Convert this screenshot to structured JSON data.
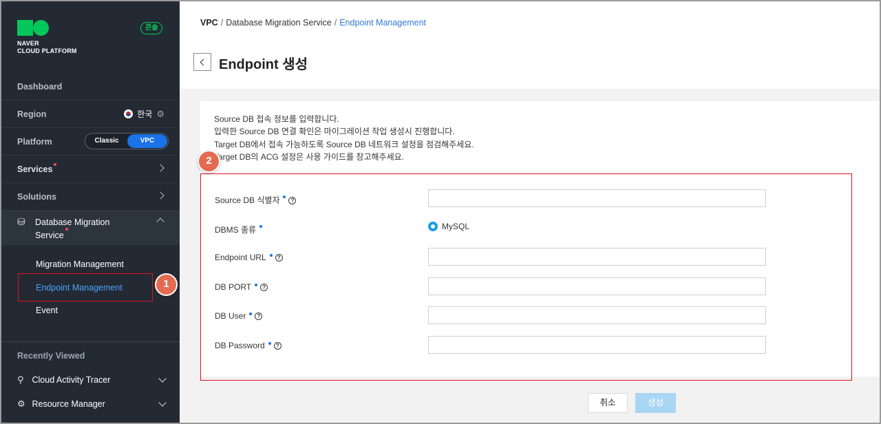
{
  "sidebar": {
    "logo": {
      "line1": "NAVER",
      "line2": "CLOUD PLATFORM"
    },
    "console_badge": "콘솔",
    "dashboard": "Dashboard",
    "region": {
      "label": "Region",
      "value": "한국"
    },
    "platform": {
      "label": "Platform",
      "option_classic": "Classic",
      "option_vpc": "VPC",
      "selected": "VPC"
    },
    "services": "Services",
    "solutions": "Solutions",
    "dms": {
      "title_line1": "Database Migration",
      "title_line2": "Service"
    },
    "sub_items": [
      "Migration Management",
      "Endpoint Management",
      "Event"
    ],
    "recent": {
      "title": "Recently Viewed",
      "items": [
        "Cloud Activity Tracer",
        "Resource Manager"
      ]
    }
  },
  "annotations": {
    "step1": "1",
    "step2": "2"
  },
  "breadcrumb": {
    "root": "VPC",
    "middle": "Database Migration Service",
    "current": "Endpoint Management"
  },
  "page": {
    "title": "Endpoint 생성"
  },
  "info": [
    "Source DB 접속 정보를 입력합니다.",
    "입력한 Source DB 연결 확인은 마이그레이션 작업 생성시 진행합니다.",
    "Target DB에서 접속 가능하도록 Source DB 네트워크 설정을 점검해주세요.",
    "Target DB의 ACG 설정은 사용 가이드를 참고해주세요."
  ],
  "form": {
    "source_db_id": {
      "label": "Source DB 식별자",
      "value": ""
    },
    "dbms_type": {
      "label": "DBMS 종류",
      "selected": "MySQL"
    },
    "endpoint_url": {
      "label": "Endpoint URL",
      "value": ""
    },
    "db_port": {
      "label": "DB PORT",
      "value": ""
    },
    "db_user": {
      "label": "DB User",
      "value": ""
    },
    "db_password": {
      "label": "DB Password",
      "value": ""
    }
  },
  "buttons": {
    "cancel": "취소",
    "create": "생성"
  },
  "colors": {
    "accent": "#1a73e8",
    "brand": "#03c75a",
    "highlight": "#e0101d",
    "sidebar_bg": "#232a33"
  }
}
